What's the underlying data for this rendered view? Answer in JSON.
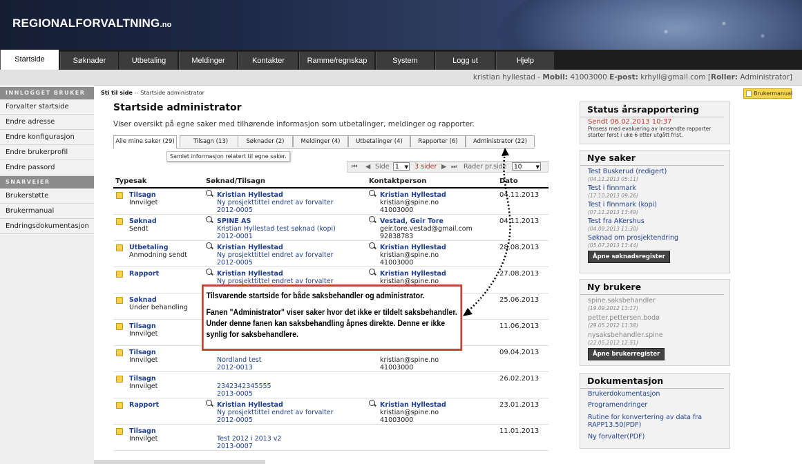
{
  "header": {
    "logo_main": "REGIONALFORVALTNING",
    "logo_tld": ".no"
  },
  "nav": [
    "Startside",
    "Søknader",
    "Utbetaling",
    "Meldinger",
    "Kontakter",
    "Ramme/regnskap",
    "System",
    "Logg ut",
    "Hjelp"
  ],
  "userbar": {
    "name": "kristian hyllestad - ",
    "mobil_label": "Mobil:",
    "mobil": " 41003000 ",
    "epost_label": "E-post:",
    "epost": " krhyll@gmail.com [",
    "roller_label": "Roller:",
    "roller": " Administrator]"
  },
  "sidebar": {
    "section1": "INNLOGGET BRUKER",
    "items1": [
      "Forvalter startside",
      "Endre adresse",
      "Endre konfigurasjon",
      "Endre brukerprofil",
      "Endre passord"
    ],
    "section2": "SNARVEIER",
    "items2": [
      "Brukerstøtte",
      "Brukermanual",
      "Endringsdokumentasjon"
    ]
  },
  "breadcrumb": {
    "label": "Sti til side",
    "sep": "››",
    "current": "Startside administrator"
  },
  "page_title": "Startside administrator",
  "description": "Viser oversikt på egne saker med tilhørende informasjon som utbetalinger, meldinger og rapporter.",
  "tabs": [
    "Alle mine saker (29)",
    "Tilsagn (13)",
    "Søknader (2)",
    "Meldinger (4)",
    "Utbetalinger (4)",
    "Rapporter (6)",
    "Administrator (22)"
  ],
  "tooltip": "Samlet informasjon relatert til egne saker.",
  "pager": {
    "side": "Side",
    "page": "1",
    "sider": "3 sider",
    "rader": "Rader pr.side",
    "count": "10"
  },
  "table": {
    "headers": [
      "Typesak",
      "Søknad/Tilsagn",
      "Kontaktperson",
      "Dato"
    ],
    "rows": [
      {
        "type": "Tilsagn",
        "status": "Innvilget",
        "s1": "Kristian Hyllestad",
        "s2": "Ny prosjekttittel endret av forvalter",
        "s3": "2012-0005",
        "k1": "Kristian Hyllestad",
        "k2": "kristian@spine.no",
        "k3": "41003000",
        "date": "04.11.2013"
      },
      {
        "type": "Søknad",
        "status": "Sendt",
        "s1": "SPINE AS",
        "s2": "Kristian Hyllestad test søknad (kopi)",
        "s3": "2012-0001",
        "k1": "Vestad, Geir Tore",
        "k2": "geir.tore.vestad@gmail.com",
        "k3": "92838783",
        "date": "04.11.2013"
      },
      {
        "type": "Utbetaling",
        "status": "Anmodning sendt",
        "s1": "Kristian Hyllestad",
        "s2": "Ny prosjekttittel endret av forvalter",
        "s3": "2012-0005",
        "k1": "Kristian Hyllestad",
        "k2": "kristian@spine.no",
        "k3": "41003000",
        "date": "28.08.2013"
      },
      {
        "type": "Rapport",
        "status": "",
        "s1": "Kristian Hyllestad",
        "s2": "Ny prosjekttittel endret av forvalter",
        "s3": "",
        "k1": "Kristian Hyllestad",
        "k2": "kristian@spine.no",
        "k3": "",
        "date": "27.08.2013"
      },
      {
        "type": "Søknad",
        "status": "Under behandling",
        "s1": "",
        "s2": "",
        "s3": "",
        "k1": "",
        "k2": "",
        "k3": "",
        "date": "25.06.2013"
      },
      {
        "type": "Tilsagn",
        "status": "Innvilget",
        "s1": "",
        "s2": "",
        "s3": "",
        "k1": "",
        "k2": "",
        "k3": "",
        "date": "11.06.2013"
      },
      {
        "type": "Tilsagn",
        "status": "Innvilget",
        "s1": "",
        "s2": "Nordland test",
        "s3": "2012-0013",
        "k1": "",
        "k2": "kristian@spine.no",
        "k3": "41003000",
        "date": "09.04.2013"
      },
      {
        "type": "Tilsagn",
        "status": "Innvilget",
        "s1": "",
        "s2": "2342342345555",
        "s3": "2013-0005",
        "k1": "",
        "k2": "",
        "k3": "",
        "date": "26.02.2013"
      },
      {
        "type": "Rapport",
        "status": "",
        "s1": "Kristian Hyllestad",
        "s2": "Ny prosjekttittel endret av forvalter",
        "s3": "2012-0005",
        "k1": "Kristian Hyllestad",
        "k2": "kristian@spine.no",
        "k3": "41003000",
        "date": "23.01.2013"
      },
      {
        "type": "Tilsagn",
        "status": "Innvilget",
        "s1": "",
        "s2": "Test 2012 i 2013 v2",
        "s3": "2013-0007",
        "k1": "",
        "k2": "",
        "k3": "",
        "date": "11.01.2013"
      }
    ]
  },
  "callout": {
    "line1": "Tilsvarende startside for både saksbehandler og administrator.",
    "line2": "Fanen \"Administrator\" viser saker hvor det ikke er tildelt saksbehandler. Under denne fanen kan saksbehandling åpnes direkte. Denne er ikke synlig for saksbehandlere."
  },
  "manual_button": "Brukermanual",
  "status_box": {
    "title": "Status årsrapportering",
    "sent": "Sendt 06.02.2013 10:37",
    "text": "Prosess med evaluering av innsendte rapporter starter først i uke 6 etter utgått frist."
  },
  "nye_saker": {
    "title": "Nye saker",
    "items": [
      {
        "name": "Test Buskerud (redigert)",
        "date": "(04.11.2013 05:11)"
      },
      {
        "name": "Test i finnmark",
        "date": "(17.10.2013 09:26)"
      },
      {
        "name": "Test i finnmark (kopi)",
        "date": "(07.11.2013 11:49)"
      },
      {
        "name": "Test fra AKershus",
        "date": "(04.09.2013 11:30)"
      },
      {
        "name": "Søknad om prosjektendring",
        "date": "(05.07.2013 11:44)"
      }
    ],
    "button": "Åpne søknadsregister"
  },
  "ny_brukere": {
    "title": "Ny brukere",
    "items": [
      {
        "name": "spine.saksbehandler",
        "date": "(19.09.2012 11:17)"
      },
      {
        "name": "petter.pettersen.bodø",
        "date": "(29.05.2012 11:38)"
      },
      {
        "name": "nysaksbehandler.spine",
        "date": "(22.05.2012 12:51)"
      }
    ],
    "button": "Åpne brukerregister"
  },
  "dokumentasjon": {
    "title": "Dokumentasjon",
    "items": [
      "Brukerdokumentasjon",
      "Programendringer",
      "Rutine for konvertering av data fra RAPP13.50(PDF)",
      "Ny forvalter(PDF)"
    ]
  },
  "colors": {
    "nav_bg": "#1d1d1d",
    "link": "#1f3f8f",
    "callout_border": "#b84a38",
    "status_sent": "#c0392b"
  }
}
